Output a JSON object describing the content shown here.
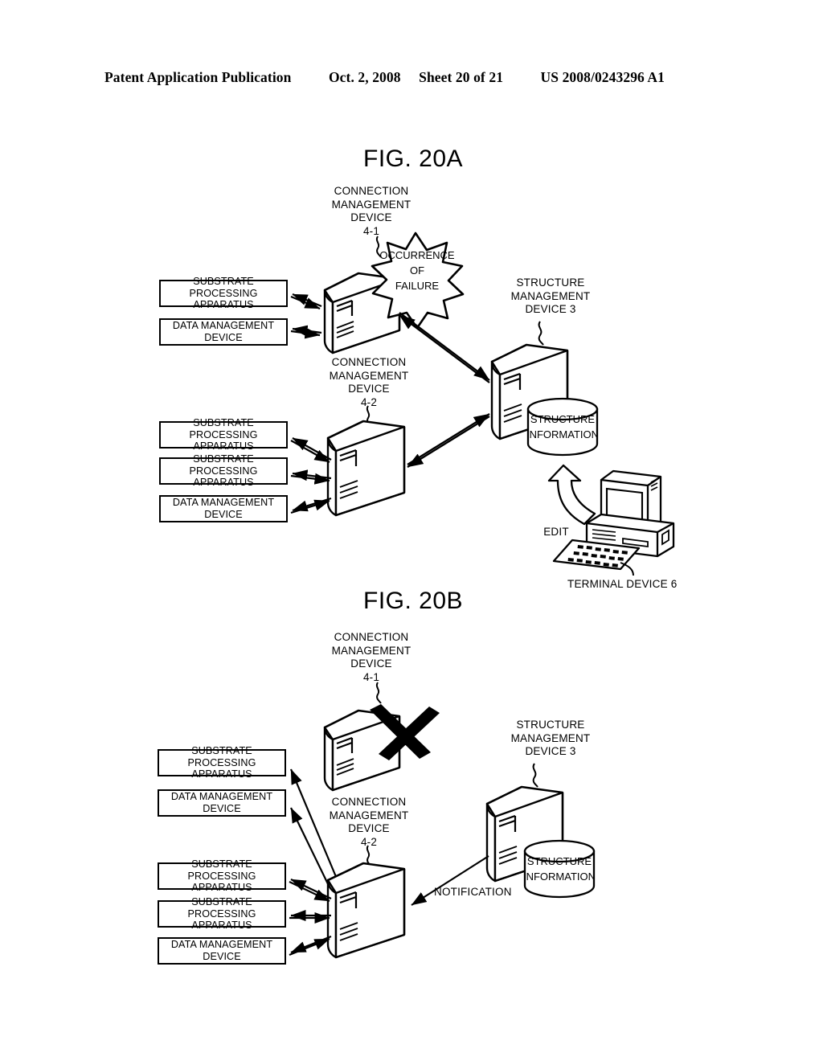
{
  "header": {
    "title": "Patent Application Publication",
    "date": "Oct. 2, 2008",
    "sheet": "Sheet 20 of 21",
    "doc_number": "US 2008/0243296 A1"
  },
  "figures": [
    {
      "id": "fig20a",
      "title": "FIG. 20A",
      "labels": {
        "cmd_4_1": "CONNECTION\nMANAGEMENT\nDEVICE\n4-1",
        "cmd_4_2": "CONNECTION\nMANAGEMENT\nDEVICE\n4-2",
        "smd_3": "STRUCTURE\nMANAGEMENT\nDEVICE 3",
        "structure_information": "STRUCTURE\nINFORMATION",
        "occurrence_of_failure": "OCCURRENCE\nOF\nFAILURE",
        "edit": "EDIT",
        "terminal_device": "TERMINAL DEVICE 6"
      },
      "boxes_upper": [
        "SUBSTRATE PROCESSING\nAPPARATUS",
        "DATA MANAGEMENT\nDEVICE"
      ],
      "boxes_lower": [
        "SUBSTRATE PROCESSING\nAPPARATUS",
        "SUBSTRATE PROCESSING\nAPPARATUS",
        "DATA MANAGEMENT\nDEVICE"
      ]
    },
    {
      "id": "fig20b",
      "title": "FIG. 20B",
      "labels": {
        "cmd_4_1": "CONNECTION\nMANAGEMENT\nDEVICE\n4-1",
        "cmd_4_2": "CONNECTION\nMANAGEMENT\nDEVICE\n4-2",
        "smd_3": "STRUCTURE\nMANAGEMENT\nDEVICE 3",
        "structure_information": "STRUCTURE\nINFORMATION",
        "notification": "NOTIFICATION"
      },
      "boxes_upper": [
        "SUBSTRATE PROCESSING\nAPPARATUS",
        "DATA MANAGEMENT\nDEVICE"
      ],
      "boxes_lower": [
        "SUBSTRATE PROCESSING\nAPPARATUS",
        "SUBSTRATE PROCESSING\nAPPARATUS",
        "DATA MANAGEMENT\nDEVICE"
      ]
    }
  ],
  "colors": {
    "ink": "#000000",
    "paper": "#ffffff"
  }
}
